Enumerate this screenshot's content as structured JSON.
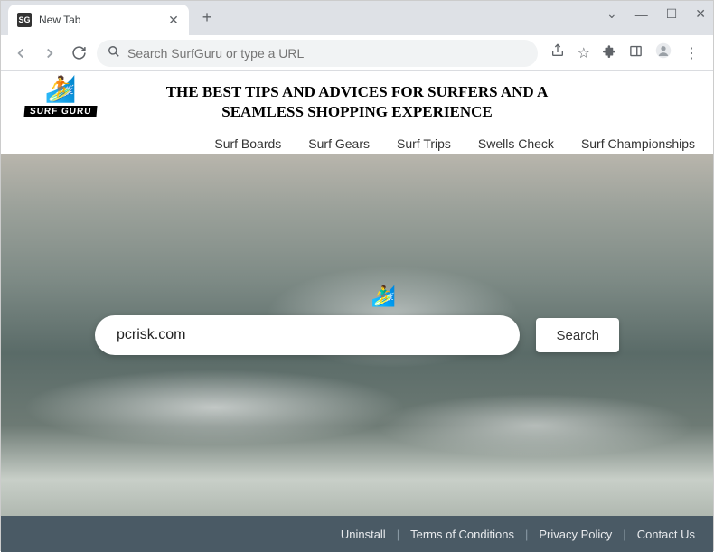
{
  "browser": {
    "tab": {
      "favicon_text": "SG",
      "title": "New Tab"
    },
    "omnibox_placeholder": "Search SurfGuru or type a URL"
  },
  "header": {
    "logo_label": "SURF GURU",
    "headline_line1": "THE BEST TIPS AND ADVICES FOR SURFERS AND A",
    "headline_line2": "SEAMLESS SHOPPING EXPERIENCE",
    "nav": [
      "Surf Boards",
      "Surf Gears",
      "Surf Trips",
      "Swells Check",
      "Surf Championships"
    ]
  },
  "search": {
    "value": "pcrisk.com",
    "button": "Search"
  },
  "footer": {
    "links": [
      "Uninstall",
      "Terms of Conditions",
      "Privacy Policy",
      "Contact Us"
    ]
  }
}
